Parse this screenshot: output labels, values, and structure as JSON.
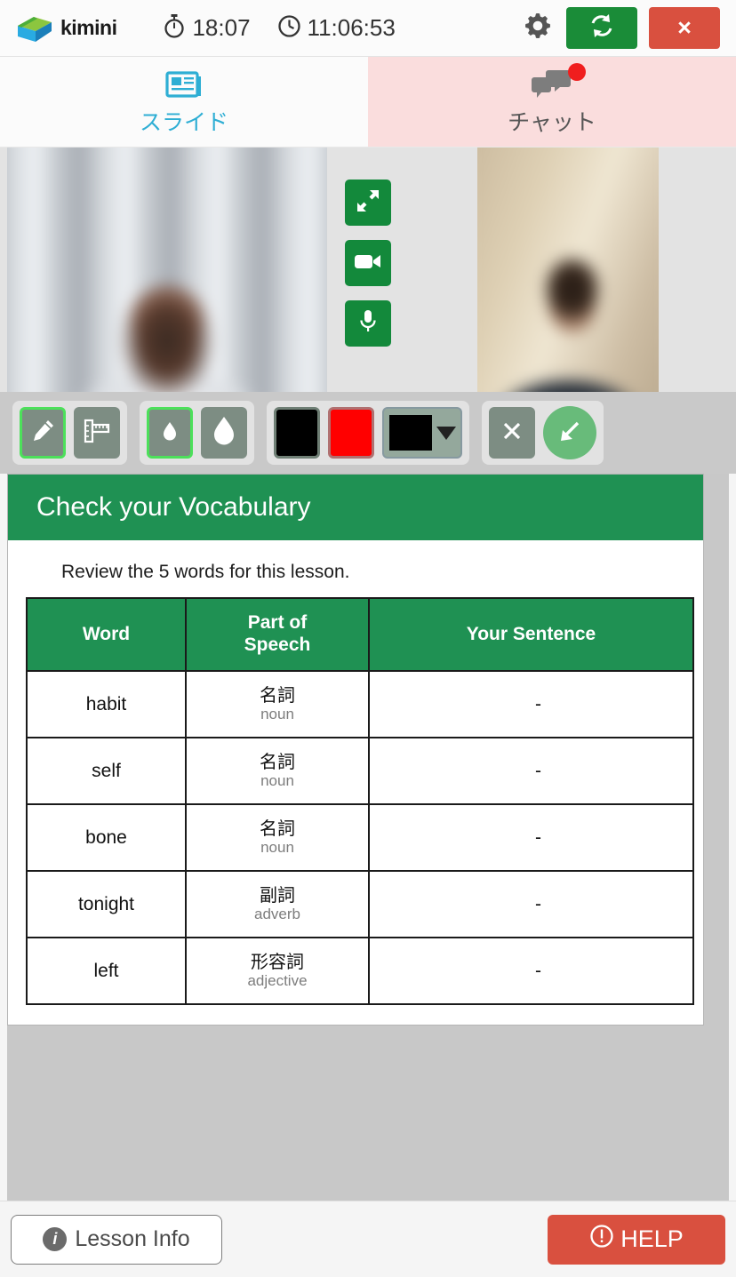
{
  "header": {
    "brand": "kimini",
    "logo_icon": "kimini-logo",
    "stopwatch_icon": "stopwatch-icon",
    "stopwatch_value": "18:07",
    "clock_icon": "clock-icon",
    "clock_value": "11:06:53",
    "settings_icon": "gear-icon",
    "reload_icon": "refresh-icon",
    "close_label": "×",
    "colors": {
      "green": "#1a8c38",
      "red": "#d9503f"
    }
  },
  "tabs": [
    {
      "label": "スライド",
      "icon": "slides-icon",
      "active": true,
      "badge": false
    },
    {
      "label": "チャット",
      "icon": "chat-bubbles-icon",
      "active": false,
      "badge": true
    }
  ],
  "video": {
    "local_label": "local-video",
    "remote_label": "remote-video",
    "controls": [
      {
        "name": "fullscreen-button",
        "icon": "expand-arrows-icon"
      },
      {
        "name": "camera-button",
        "icon": "video-camera-icon"
      },
      {
        "name": "microphone-button",
        "icon": "microphone-icon"
      }
    ]
  },
  "toolbar": {
    "groups": [
      {
        "buttons": [
          {
            "name": "pen-tool",
            "icon": "pen-icon",
            "selected": true
          },
          {
            "name": "ruler-tool",
            "icon": "ruler-icon",
            "selected": false
          }
        ]
      },
      {
        "buttons": [
          {
            "name": "thin-stroke-tool",
            "icon": "small-droplet-icon",
            "selected": true
          },
          {
            "name": "thick-stroke-tool",
            "icon": "large-droplet-icon",
            "selected": false
          }
        ]
      },
      {
        "buttons": [
          {
            "name": "color-black",
            "icon": "black-swatch",
            "color": "#000000"
          },
          {
            "name": "color-red",
            "icon": "red-swatch",
            "color": "#ff0000"
          },
          {
            "name": "color-picker",
            "icon": "color-dropdown",
            "color": "#000000"
          }
        ]
      },
      {
        "buttons": [
          {
            "name": "clear-drawing",
            "icon": "close-x-icon"
          },
          {
            "name": "collapse-toolbar",
            "icon": "arrow-down-left-icon"
          }
        ]
      }
    ]
  },
  "slide": {
    "title": "Check your Vocabulary",
    "subtitle": "Review the 5 words for this lesson.",
    "table": {
      "headers": [
        "Word",
        "Part of\nSpeech",
        "Your Sentence"
      ],
      "header_word": "Word",
      "header_pos_line1": "Part of",
      "header_pos_line2": "Speech",
      "header_sentence": "Your Sentence",
      "rows": [
        {
          "word": "habit",
          "pos_jp": "名詞",
          "pos_en": "noun",
          "sentence": "-"
        },
        {
          "word": "self",
          "pos_jp": "名詞",
          "pos_en": "noun",
          "sentence": "-"
        },
        {
          "word": "bone",
          "pos_jp": "名詞",
          "pos_en": "noun",
          "sentence": "-"
        },
        {
          "word": "tonight",
          "pos_jp": "副詞",
          "pos_en": "adverb",
          "sentence": "-"
        },
        {
          "word": "left",
          "pos_jp": "形容詞",
          "pos_en": "adjective",
          "sentence": "-"
        }
      ]
    },
    "accent_color": "#1f9153"
  },
  "footer": {
    "lesson_info_label": "Lesson Info",
    "lesson_info_icon": "info-icon",
    "help_label": "HELP",
    "help_icon": "exclamation-circle-icon",
    "help_color": "#d9503f"
  }
}
